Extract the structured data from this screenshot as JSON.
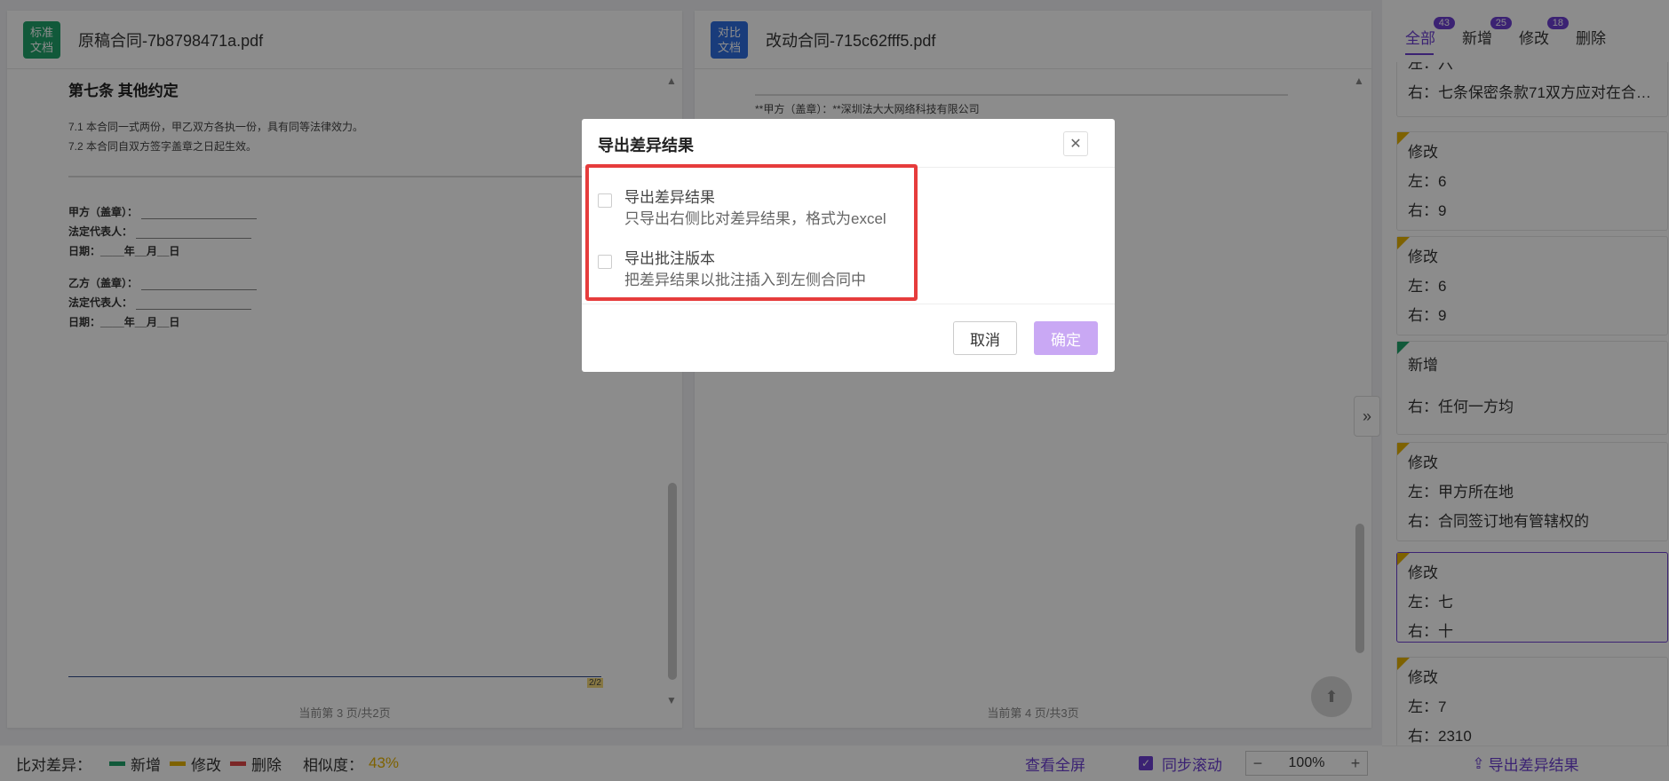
{
  "left_doc": {
    "badge": "标准\n文档",
    "file_name": "原稿合同-7b8798471a.pdf",
    "article_title": "第七条 其他约定",
    "clause_1": "7.1 本合同一式两份，甲乙双方各执一份，具有同等法律效力。",
    "clause_2": "7.2 本合同自双方签字盖章之日起生效。",
    "sign_a": "甲方（盖章）：",
    "sign_rep": "法定代表人：",
    "sign_date": "日期：____年__月__日",
    "sign_b": "乙方（盖章）：",
    "sign_rep_b": "法定代表人：",
    "sign_date_b": "日期：____年__月__日",
    "page_mark": "2/2",
    "page_info": "当前第 3 页/共2页"
  },
  "right_doc": {
    "badge": "对比\n文档",
    "file_name": "改动合同-715c62fff5.pdf",
    "snippet": "**甲方（盖章）：**深圳法大大网络科技有限公司",
    "page_info": "当前第 4 页/共3页"
  },
  "sidebar": {
    "tabs": [
      {
        "label": "全部",
        "count": "43"
      },
      {
        "label": "新增",
        "count": "25"
      },
      {
        "label": "修改",
        "count": "18"
      },
      {
        "label": "删除",
        "count": ""
      }
    ],
    "cards": [
      {
        "type": "",
        "left": "左：六",
        "right": "右：七条保密条款71双方应对在合作..."
      },
      {
        "type": "修改",
        "left": "左：6",
        "right": "右：9"
      },
      {
        "type": "修改",
        "left": "左：6",
        "right": "右：9"
      },
      {
        "type": "新增",
        "left": "",
        "right": "右：任何一方均"
      },
      {
        "type": "修改",
        "left": "左：甲方所在地",
        "right": "右：合同签订地有管辖权的"
      },
      {
        "type": "修改",
        "left": "左：七",
        "right": "右：十"
      },
      {
        "type": "修改",
        "left": "左：7",
        "right": "右：2310"
      }
    ],
    "export_label": "导出差异结果"
  },
  "bottom_bar": {
    "legend_title": "比对差异：",
    "legend_add": "新增",
    "legend_modify": "修改",
    "legend_delete": "删除",
    "similarity_label": "相似度：",
    "similarity_value": "43%",
    "fullscreen": "查看全屏",
    "sync_scroll": "同步滚动",
    "zoom_minus": "−",
    "zoom_value": "100%",
    "zoom_plus": "+"
  },
  "dialog": {
    "title": "导出差异结果",
    "option_1_label": "导出差异结果",
    "option_1_desc": "只导出右侧比对差异结果，格式为excel",
    "option_2_label": "导出批注版本",
    "option_2_desc": "把差异结果以批注插入到左侧合同中",
    "cancel": "取消",
    "confirm": "确定"
  },
  "colors": {
    "accent": "#6c3fd1",
    "add": "#1fa36b",
    "modify": "#e6b200",
    "delete": "#e04848",
    "highlight_border": "#e63c3c"
  }
}
